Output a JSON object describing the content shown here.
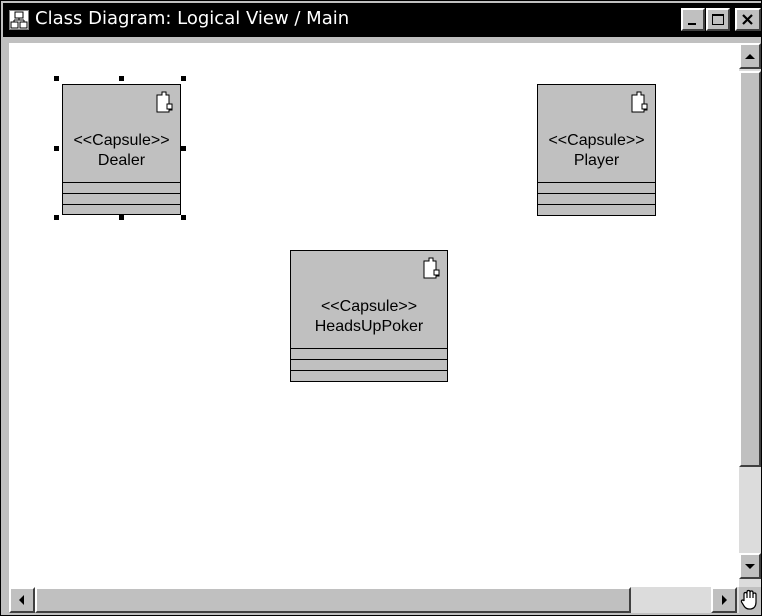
{
  "window": {
    "title": "Class Diagram: Logical View / Main",
    "controls": [
      "minimize",
      "restore",
      "close"
    ]
  },
  "diagram": {
    "capsules": [
      {
        "stereotype": "<<Capsule>>",
        "name": "Dealer",
        "selected": true
      },
      {
        "stereotype": "<<Capsule>>",
        "name": "Player",
        "selected": false
      },
      {
        "stereotype": "<<Capsule>>",
        "name": "HeadsUpPoker",
        "selected": false
      }
    ]
  },
  "icons": {
    "window": "class-diagram-icon",
    "capsule": "capsule-icon",
    "pan": "hand-pan-icon"
  },
  "colors": {
    "titlebar": "#000000",
    "capsule_fill": "#c0c0c0",
    "canvas": "#ffffff"
  }
}
